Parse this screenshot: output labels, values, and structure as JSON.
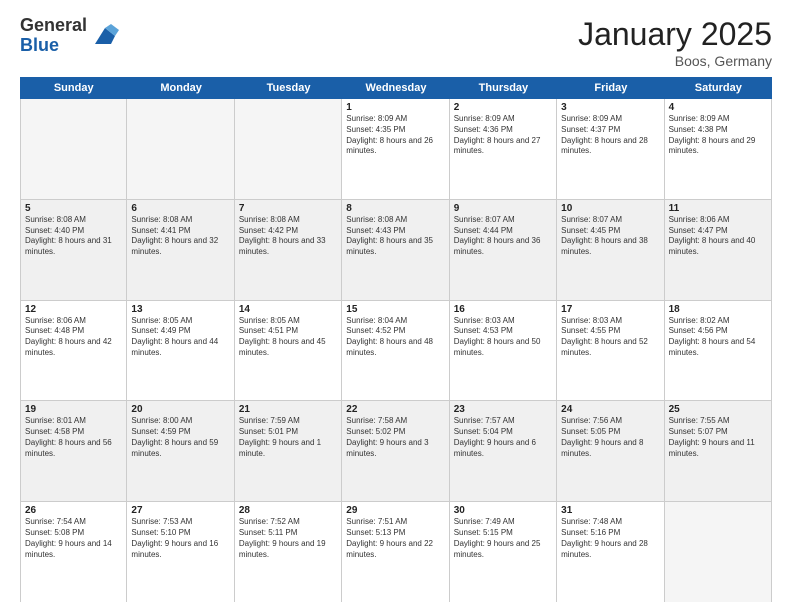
{
  "logo": {
    "general": "General",
    "blue": "Blue"
  },
  "header": {
    "month": "January 2025",
    "location": "Boos, Germany"
  },
  "weekdays": [
    "Sunday",
    "Monday",
    "Tuesday",
    "Wednesday",
    "Thursday",
    "Friday",
    "Saturday"
  ],
  "weeks": [
    [
      {
        "day": "",
        "info": "",
        "empty": true
      },
      {
        "day": "",
        "info": "",
        "empty": true
      },
      {
        "day": "",
        "info": "",
        "empty": true
      },
      {
        "day": "1",
        "info": "Sunrise: 8:09 AM\nSunset: 4:35 PM\nDaylight: 8 hours and 26 minutes."
      },
      {
        "day": "2",
        "info": "Sunrise: 8:09 AM\nSunset: 4:36 PM\nDaylight: 8 hours and 27 minutes."
      },
      {
        "day": "3",
        "info": "Sunrise: 8:09 AM\nSunset: 4:37 PM\nDaylight: 8 hours and 28 minutes."
      },
      {
        "day": "4",
        "info": "Sunrise: 8:09 AM\nSunset: 4:38 PM\nDaylight: 8 hours and 29 minutes."
      }
    ],
    [
      {
        "day": "5",
        "info": "Sunrise: 8:08 AM\nSunset: 4:40 PM\nDaylight: 8 hours and 31 minutes.",
        "shaded": true
      },
      {
        "day": "6",
        "info": "Sunrise: 8:08 AM\nSunset: 4:41 PM\nDaylight: 8 hours and 32 minutes.",
        "shaded": true
      },
      {
        "day": "7",
        "info": "Sunrise: 8:08 AM\nSunset: 4:42 PM\nDaylight: 8 hours and 33 minutes.",
        "shaded": true
      },
      {
        "day": "8",
        "info": "Sunrise: 8:08 AM\nSunset: 4:43 PM\nDaylight: 8 hours and 35 minutes.",
        "shaded": true
      },
      {
        "day": "9",
        "info": "Sunrise: 8:07 AM\nSunset: 4:44 PM\nDaylight: 8 hours and 36 minutes.",
        "shaded": true
      },
      {
        "day": "10",
        "info": "Sunrise: 8:07 AM\nSunset: 4:45 PM\nDaylight: 8 hours and 38 minutes.",
        "shaded": true
      },
      {
        "day": "11",
        "info": "Sunrise: 8:06 AM\nSunset: 4:47 PM\nDaylight: 8 hours and 40 minutes.",
        "shaded": true
      }
    ],
    [
      {
        "day": "12",
        "info": "Sunrise: 8:06 AM\nSunset: 4:48 PM\nDaylight: 8 hours and 42 minutes."
      },
      {
        "day": "13",
        "info": "Sunrise: 8:05 AM\nSunset: 4:49 PM\nDaylight: 8 hours and 44 minutes."
      },
      {
        "day": "14",
        "info": "Sunrise: 8:05 AM\nSunset: 4:51 PM\nDaylight: 8 hours and 45 minutes."
      },
      {
        "day": "15",
        "info": "Sunrise: 8:04 AM\nSunset: 4:52 PM\nDaylight: 8 hours and 48 minutes."
      },
      {
        "day": "16",
        "info": "Sunrise: 8:03 AM\nSunset: 4:53 PM\nDaylight: 8 hours and 50 minutes."
      },
      {
        "day": "17",
        "info": "Sunrise: 8:03 AM\nSunset: 4:55 PM\nDaylight: 8 hours and 52 minutes."
      },
      {
        "day": "18",
        "info": "Sunrise: 8:02 AM\nSunset: 4:56 PM\nDaylight: 8 hours and 54 minutes."
      }
    ],
    [
      {
        "day": "19",
        "info": "Sunrise: 8:01 AM\nSunset: 4:58 PM\nDaylight: 8 hours and 56 minutes.",
        "shaded": true
      },
      {
        "day": "20",
        "info": "Sunrise: 8:00 AM\nSunset: 4:59 PM\nDaylight: 8 hours and 59 minutes.",
        "shaded": true
      },
      {
        "day": "21",
        "info": "Sunrise: 7:59 AM\nSunset: 5:01 PM\nDaylight: 9 hours and 1 minute.",
        "shaded": true
      },
      {
        "day": "22",
        "info": "Sunrise: 7:58 AM\nSunset: 5:02 PM\nDaylight: 9 hours and 3 minutes.",
        "shaded": true
      },
      {
        "day": "23",
        "info": "Sunrise: 7:57 AM\nSunset: 5:04 PM\nDaylight: 9 hours and 6 minutes.",
        "shaded": true
      },
      {
        "day": "24",
        "info": "Sunrise: 7:56 AM\nSunset: 5:05 PM\nDaylight: 9 hours and 8 minutes.",
        "shaded": true
      },
      {
        "day": "25",
        "info": "Sunrise: 7:55 AM\nSunset: 5:07 PM\nDaylight: 9 hours and 11 minutes.",
        "shaded": true
      }
    ],
    [
      {
        "day": "26",
        "info": "Sunrise: 7:54 AM\nSunset: 5:08 PM\nDaylight: 9 hours and 14 minutes."
      },
      {
        "day": "27",
        "info": "Sunrise: 7:53 AM\nSunset: 5:10 PM\nDaylight: 9 hours and 16 minutes."
      },
      {
        "day": "28",
        "info": "Sunrise: 7:52 AM\nSunset: 5:11 PM\nDaylight: 9 hours and 19 minutes."
      },
      {
        "day": "29",
        "info": "Sunrise: 7:51 AM\nSunset: 5:13 PM\nDaylight: 9 hours and 22 minutes."
      },
      {
        "day": "30",
        "info": "Sunrise: 7:49 AM\nSunset: 5:15 PM\nDaylight: 9 hours and 25 minutes."
      },
      {
        "day": "31",
        "info": "Sunrise: 7:48 AM\nSunset: 5:16 PM\nDaylight: 9 hours and 28 minutes."
      },
      {
        "day": "",
        "info": "",
        "empty": true
      }
    ]
  ]
}
